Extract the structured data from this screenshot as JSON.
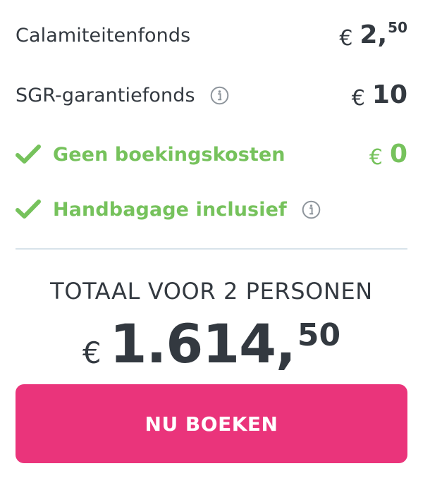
{
  "rows": [
    {
      "label": "Calamiteitenfonds",
      "currency": "€",
      "integer": "2",
      "comma": ",",
      "cents": "50"
    },
    {
      "label": "SGR-garantiefonds",
      "currency": "€",
      "integer": "10",
      "info_icon": "info-icon"
    },
    {
      "label": "Geen boekingskosten",
      "currency": "€",
      "integer": "0",
      "icon": "check-icon"
    },
    {
      "label": "Handbagage inclusief",
      "icon": "check-icon",
      "info_icon": "info-icon"
    }
  ],
  "total": {
    "title": "TOTAAL VOOR 2 PERSONEN",
    "currency": "€",
    "integer": "1.614",
    "comma": ",",
    "cents": "50"
  },
  "book_button": {
    "label": "NU BOEKEN"
  },
  "colors": {
    "text": "#333940",
    "green": "#76c25c",
    "pink": "#ea347b",
    "divider": "#d7e3ea",
    "info": "#8e959c"
  }
}
